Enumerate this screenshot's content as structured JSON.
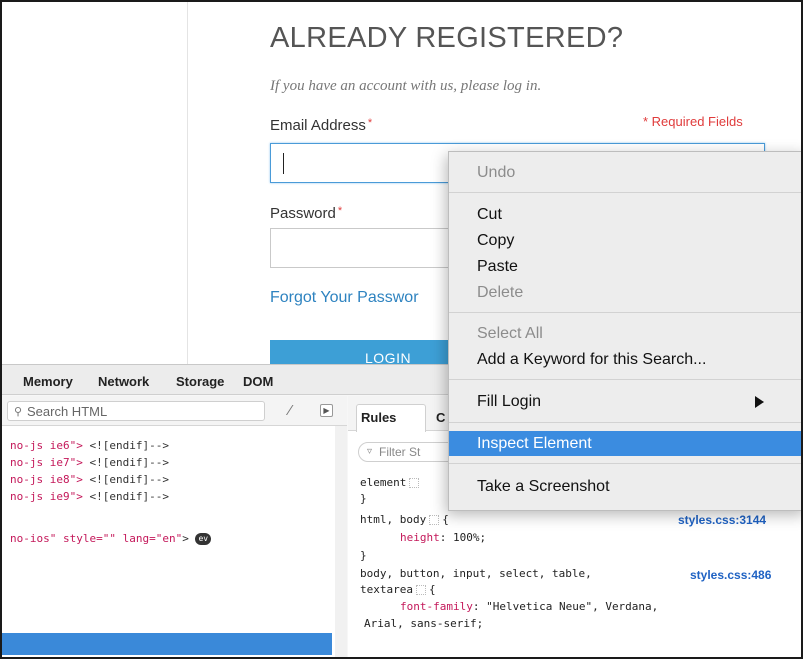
{
  "page": {
    "heading": "ALREADY REGISTERED?",
    "subtext": "If you have an account with us, please log in.",
    "email_label": "Email Address",
    "password_label": "Password",
    "required_star": "*",
    "required_note": "* Required Fields",
    "forgot_link": "Forgot Your Passwor",
    "login_button": "LOGIN"
  },
  "devtools": {
    "tabs": [
      "Memory",
      "Network",
      "Storage",
      "DOM"
    ],
    "search_placeholder": "Search HTML",
    "html_lines": [
      {
        "attr": "no-js ie6\"> ",
        "rest": "<![endif]-->"
      },
      {
        "attr": "no-js ie7\"> ",
        "rest": "<![endif]-->"
      },
      {
        "attr": "no-js ie8\"> ",
        "rest": "<![endif]-->"
      },
      {
        "attr": "no-js ie9\"> ",
        "rest": "<![endif]-->"
      }
    ],
    "html_root": {
      "a": "no-ios\"",
      "b": " style=",
      "c": "\"\"",
      "d": " lang=",
      "e": "\"en\"",
      "f": ">",
      "badge": "ev"
    },
    "rules_tab": "Rules",
    "rules_tab2": "C",
    "filter_placeholder": "Filter St",
    "rules": {
      "element_selector": "element",
      "element_close": "}",
      "html_body_selector": "html, body",
      "html_body_source": "styles.css:3144",
      "height_prop": "height",
      "height_val": "100%;",
      "html_body_close": "}",
      "body_sel_line1": "body, button, input, select, table,",
      "body_sel_line2": "textarea",
      "body_source": "styles.css:486",
      "font_prop": "font-family",
      "font_val1": "\"Helvetica Neue\", Verdana,",
      "font_val2": "Arial, sans-serif;"
    }
  },
  "context_menu": {
    "undo": "Undo",
    "cut": "Cut",
    "copy": "Copy",
    "paste": "Paste",
    "delete": "Delete",
    "select_all": "Select All",
    "add_keyword": "Add a Keyword for this Search...",
    "fill_login": "Fill Login",
    "inspect": "Inspect Element",
    "screenshot": "Take a Screenshot"
  }
}
